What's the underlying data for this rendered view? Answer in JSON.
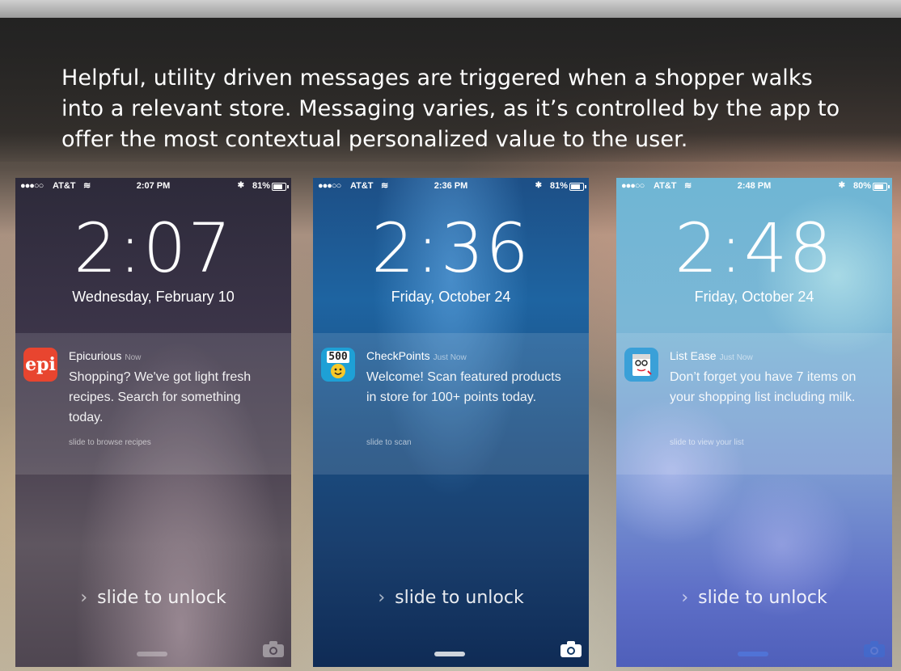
{
  "headline": "Helpful, utility driven messages are triggered when a shopper walks into a relevant store. Messaging varies, as it’s controlled by the app to offer the most contextual personalized value to the user.",
  "phones": [
    {
      "signal": "●●●○○",
      "carrier": "AT&T",
      "status_time": "2:07 PM",
      "battery": "81%",
      "battery_level": 0.81,
      "clock": "2:07",
      "date": "Wednesday, February 10",
      "notification": {
        "app_icon_label": "epi",
        "app_icon_color": "#e8452f",
        "app_name": "Epicurious",
        "time": "Now",
        "message": "Shopping? We've got light fresh recipes. Search for something today.",
        "action": "slide to browse recipes"
      },
      "unlock": "slide to unlock"
    },
    {
      "signal": "●●●○○",
      "carrier": "AT&T",
      "status_time": "2:36 PM",
      "battery": "81%",
      "battery_level": 0.81,
      "clock": "2:36",
      "date": "Friday, October 24",
      "notification": {
        "app_icon_label": "500",
        "app_icon_color": "#1ea0d6",
        "app_name": "CheckPoints",
        "time": "Just Now",
        "message": "Welcome! Scan featured products in store for 100+ points today.",
        "action": "slide to scan"
      },
      "unlock": "slide to unlock"
    },
    {
      "signal": "●●●○○",
      "carrier": "AT&T",
      "status_time": "2:48 PM",
      "battery": "80%",
      "battery_level": 0.8,
      "clock": "2:48",
      "date": "Friday, October 24",
      "notification": {
        "app_icon_label": "",
        "app_icon_color": "#3aa0d8",
        "app_name": "List Ease",
        "time": "Just Now",
        "message": "Don’t forget you have 7 items on your shopping list including milk.",
        "action": "slide to view your list"
      },
      "unlock": "slide to unlock"
    }
  ]
}
